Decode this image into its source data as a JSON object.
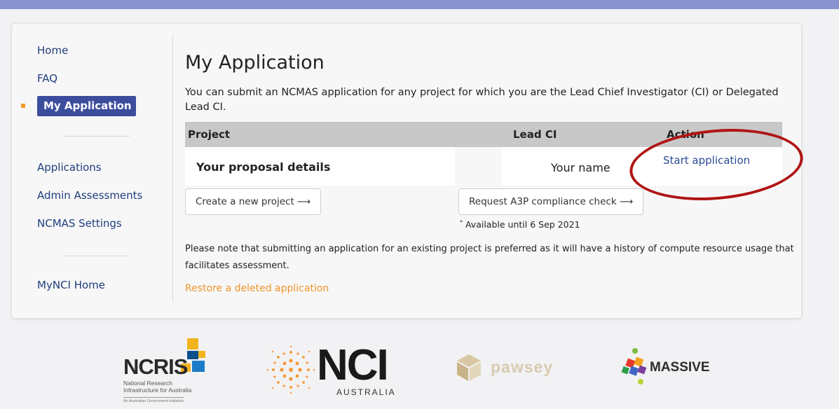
{
  "nav": {
    "home": "Home",
    "faq": "FAQ",
    "my_application": "My Application",
    "applications": "Applications",
    "admin_assessments": "Admin Assessments",
    "ncmas_settings": "NCMAS Settings",
    "mynci_home": "MyNCI Home"
  },
  "main": {
    "title": "My Application",
    "intro": "You can submit an NCMAS application for any project for which you are the Lead Chief Investigator (CI) or Delegated Lead CI.",
    "table": {
      "headers": {
        "project": "Project",
        "lead_ci": "Lead CI",
        "action": "Action"
      },
      "row": {
        "project": "Your proposal details",
        "lead_ci": "Your name",
        "action": "Start application"
      }
    },
    "create_project_button": "Create a new project  ⟶",
    "request_a3p_button": "Request A3P compliance check  ⟶",
    "footnote_mark": "*",
    "footnote": "Available until 6 Sep 2021",
    "note": "Please note that submitting an application for an existing project is preferred as it will have a history of compute resource usage that facilitates assessment.",
    "restore_link": "Restore a deleted application"
  },
  "logos": {
    "ncris": {
      "name": "NCRIS",
      "line1": "National Research",
      "line2": "Infrastructure for Australia",
      "line3": "An Australian Government Initiative"
    },
    "nci": {
      "name": "NCI",
      "sub": "AUSTRALIA"
    },
    "pawsey": {
      "name": "pawsey"
    },
    "massive": {
      "name": "MASSIVE"
    }
  },
  "colors": {
    "accent_nav": "#3d4d9d",
    "top_bar": "#8a92cf",
    "link": "#1f3e7e",
    "orange": "#f0962a",
    "annotation_oval": "#b01414"
  }
}
